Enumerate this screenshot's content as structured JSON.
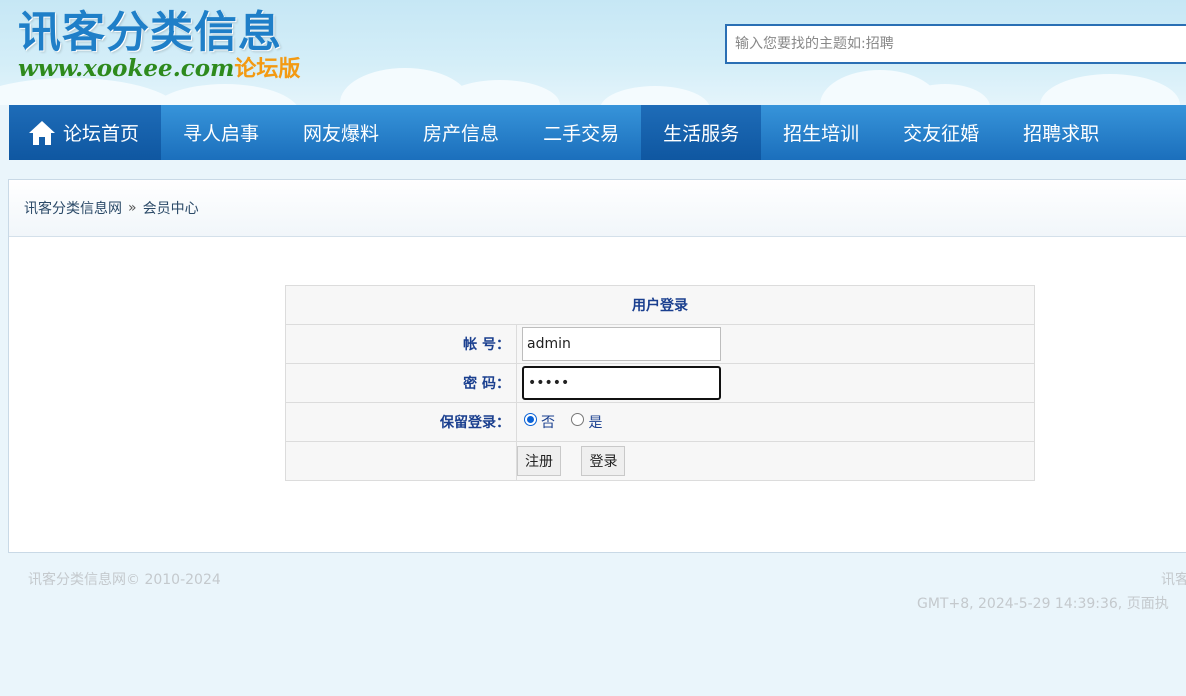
{
  "header": {
    "logo_cn": "讯客分类信息",
    "logo_url": "www.xookee.com",
    "logo_suffix": "论坛版",
    "search_placeholder": "输入您要找的主题如:招聘"
  },
  "nav": {
    "items": [
      {
        "label": "论坛首页",
        "icon": "home-icon"
      },
      {
        "label": "寻人启事"
      },
      {
        "label": "网友爆料"
      },
      {
        "label": "房产信息"
      },
      {
        "label": "二手交易"
      },
      {
        "label": "生活服务"
      },
      {
        "label": "招生培训"
      },
      {
        "label": "交友征婚"
      },
      {
        "label": "招聘求职"
      }
    ]
  },
  "breadcrumb": {
    "site": "讯客分类信息网",
    "separator": "»",
    "current": "会员中心"
  },
  "login": {
    "title": "用户登录",
    "account_label": "帐 号：",
    "account_value": "admin",
    "password_label": "密 码：",
    "password_value": "•••••",
    "remember_label": "保留登录：",
    "remember_no": "否",
    "remember_yes": "是",
    "register_button": "注册",
    "login_button": "登录"
  },
  "footer": {
    "copyright": "讯客分类信息网© 2010-2024",
    "right_line1": "讯客",
    "right_line2": "GMT+8, 2024-5-29 14:39:36, 页面执"
  },
  "colors": {
    "nav_blue": "#2a86d0",
    "nav_active": "#1560aa",
    "label_blue": "#1a3f8f"
  }
}
